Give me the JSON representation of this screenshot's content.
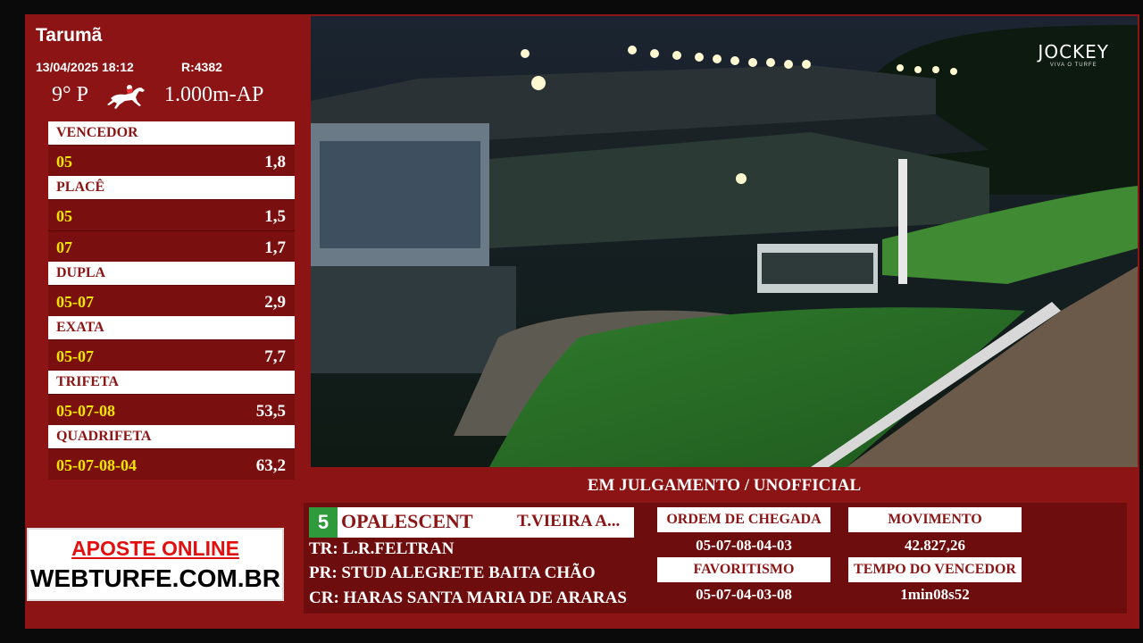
{
  "race": {
    "track": "Tarumã",
    "datetime": "13/04/2025 18:12",
    "race_id": "R:4382",
    "race_number": "9° P",
    "distance": "1.000m-AP"
  },
  "bets": [
    {
      "type": "VENCEDOR",
      "rows": [
        {
          "combo": "05",
          "value": "1,8"
        }
      ]
    },
    {
      "type": "PLACÊ",
      "rows": [
        {
          "combo": "05",
          "value": "1,5"
        },
        {
          "combo": "07",
          "value": "1,7"
        }
      ]
    },
    {
      "type": "DUPLA",
      "rows": [
        {
          "combo": "05-07",
          "value": "2,9"
        }
      ]
    },
    {
      "type": "EXATA",
      "rows": [
        {
          "combo": "05-07",
          "value": "7,7"
        }
      ]
    },
    {
      "type": "TRIFETA",
      "rows": [
        {
          "combo": "05-07-08",
          "value": "53,5"
        }
      ]
    },
    {
      "type": "QUADRIFETA",
      "rows": [
        {
          "combo": "05-07-08-04",
          "value": "63,2"
        }
      ]
    }
  ],
  "ad": {
    "line1": "APOSTE ONLINE",
    "line2": "WEBTURFE.COM.BR"
  },
  "broadcast": {
    "logo": "JOCKEY",
    "logo_sub": "VIVA O TURFE"
  },
  "status": "EM JULGAMENTO / UNOFFICIAL",
  "winner": {
    "number": "5",
    "name": "OPALESCENT",
    "jockey": "T.VIEIRA A...",
    "trainer": "TR: L.R.FELTRAN",
    "owner": "PR: STUD ALEGRETE BAITA CHÃO",
    "breeder": "CR: HARAS SANTA MARIA DE ARARAS"
  },
  "stats": {
    "ordem_label": "ORDEM DE CHEGADA",
    "ordem_value": "05-07-08-04-03",
    "favoritismo_label": "FAVORITISMO",
    "favoritismo_value": "05-07-04-03-08",
    "movimento_label": "MOVIMENTO",
    "movimento_value": "42.827,26",
    "tempo_label": "TEMPO DO VENCEDOR",
    "tempo_value": "1min08s52"
  },
  "colors": {
    "frame": "#8c1414",
    "bet_row": "#7a0f0f",
    "combo": "#f2e600",
    "winner_badge": "#2e9a3c"
  }
}
